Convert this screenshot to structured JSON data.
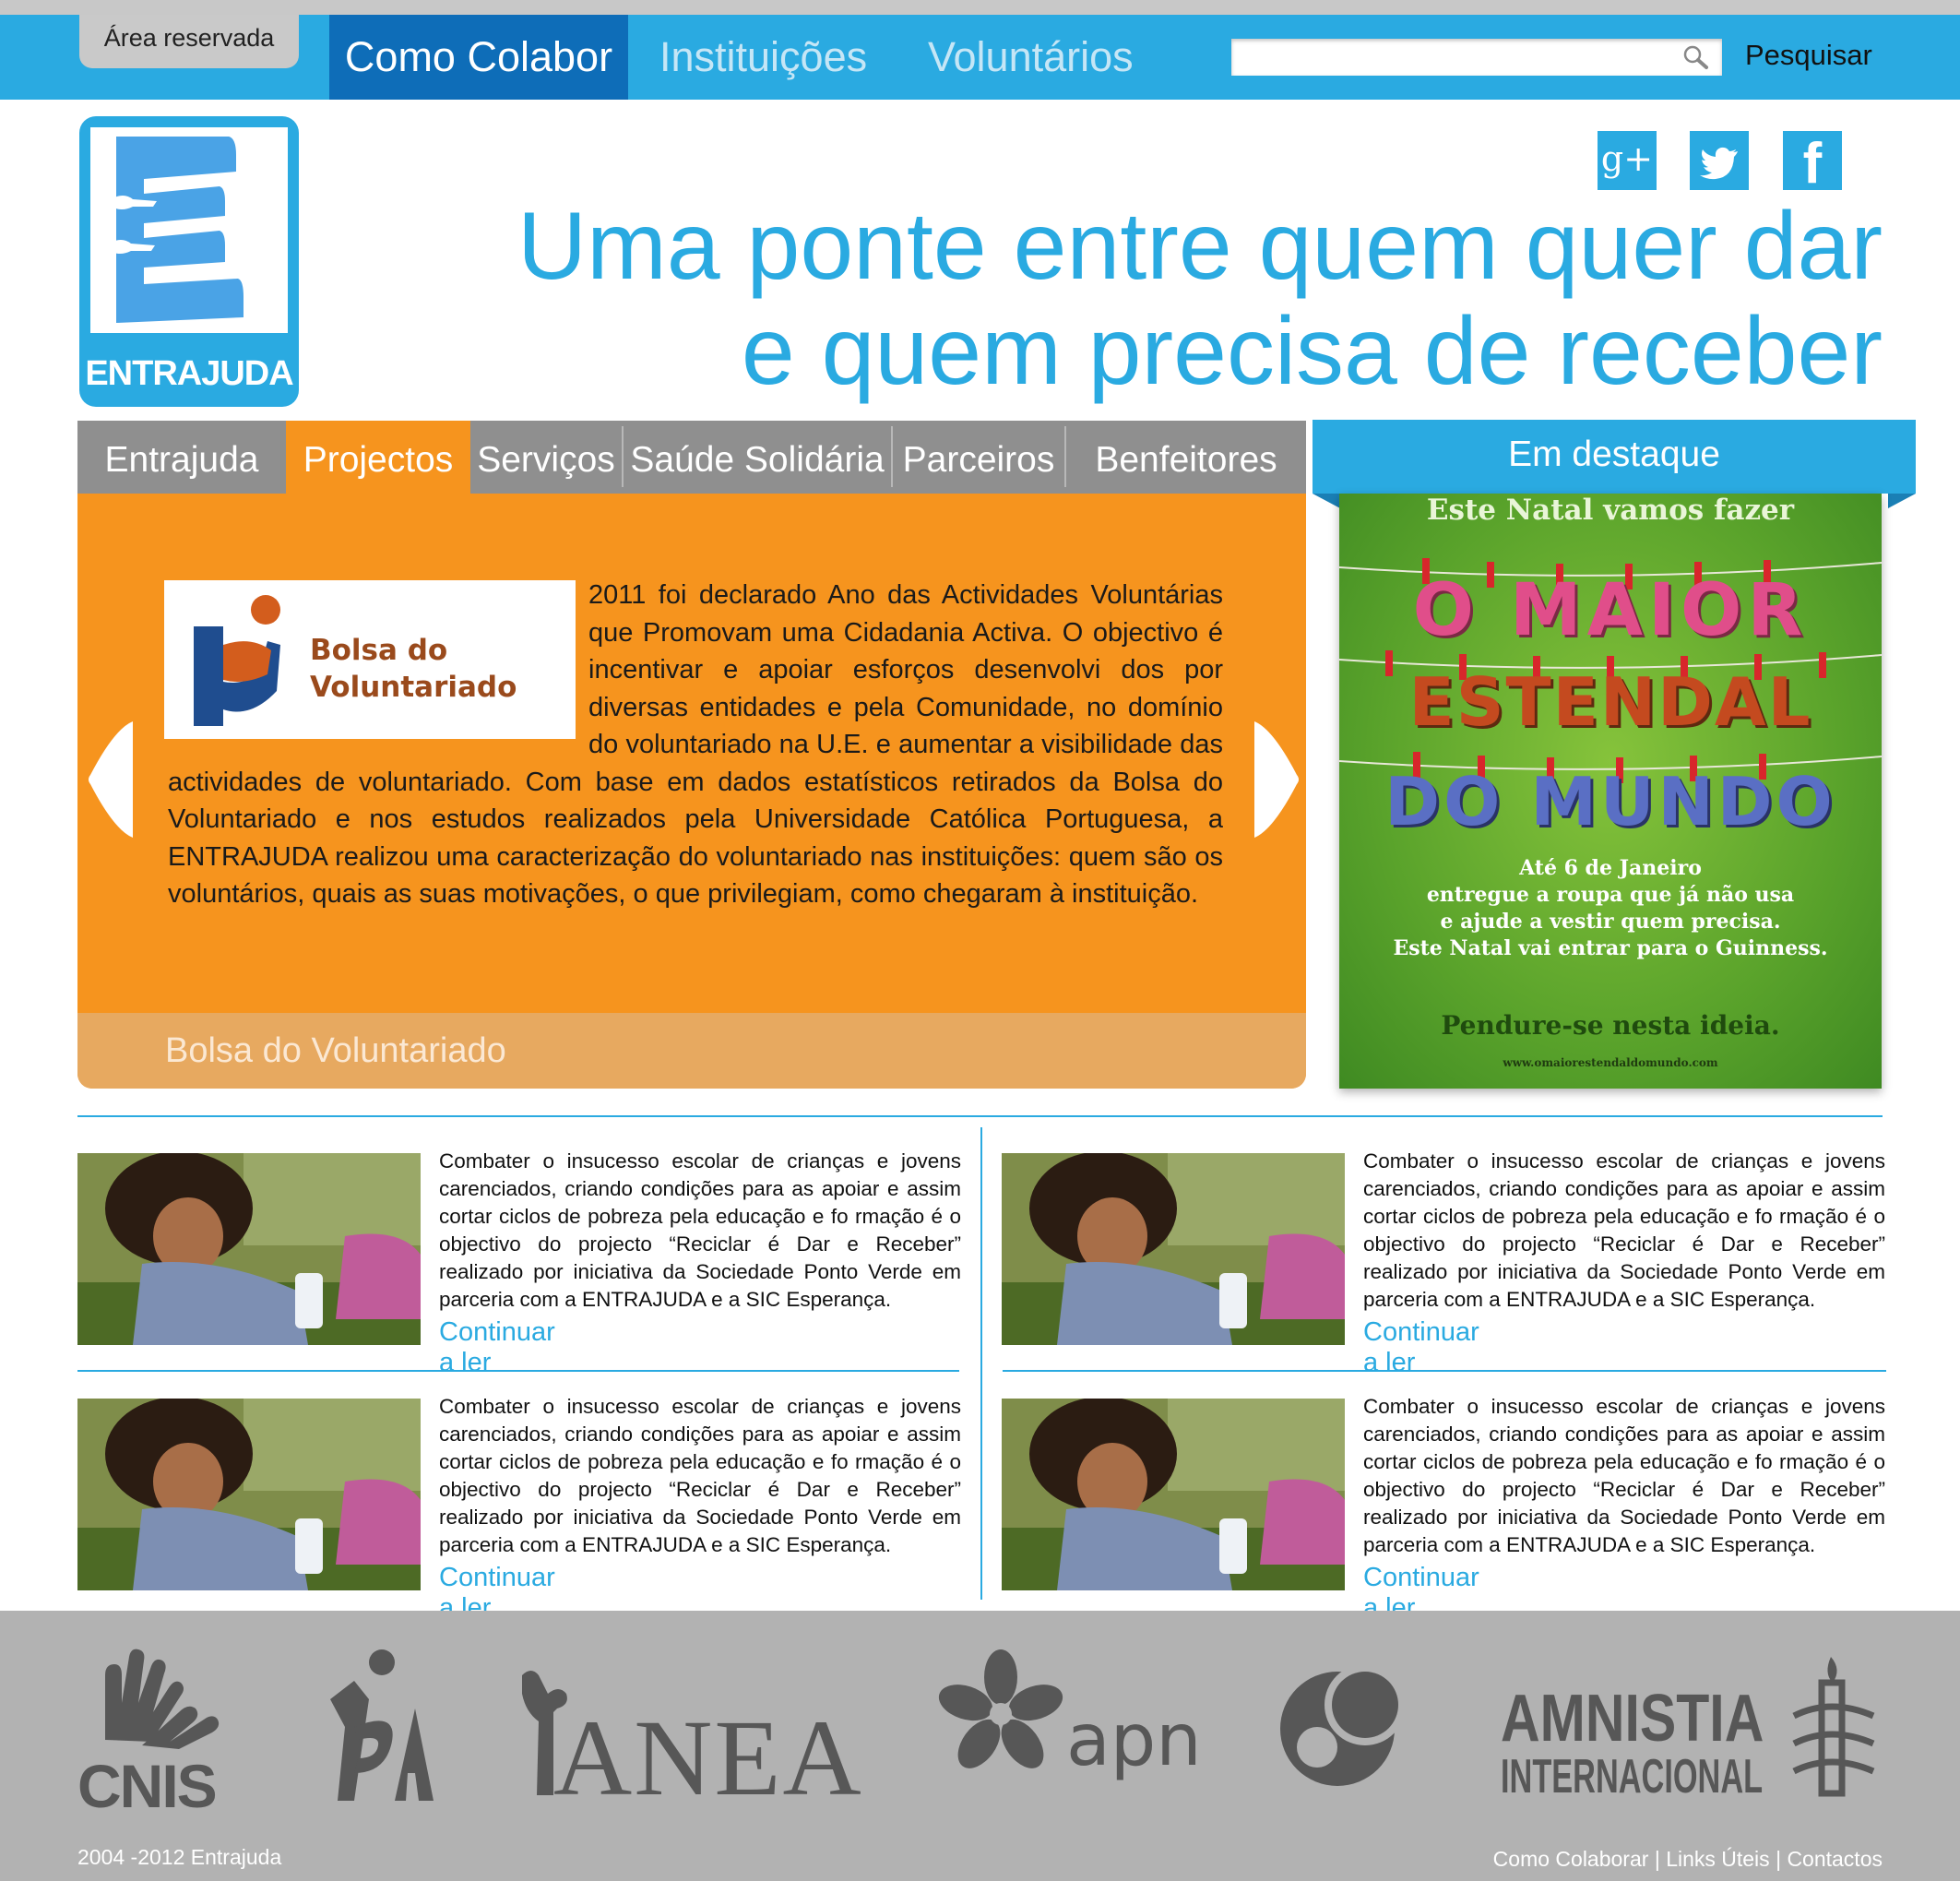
{
  "topbar": {
    "area_reservada": "Área reservada",
    "nav": [
      "Como Colabor",
      "Instituições",
      "Voluntários"
    ],
    "search_placeholder": "",
    "search_button": "Pesquisar"
  },
  "logo": {
    "text": "ENTRAJUDA"
  },
  "social": [
    {
      "icon": "google-plus-icon",
      "glyph": "g+"
    },
    {
      "icon": "twitter-icon",
      "glyph": ""
    },
    {
      "icon": "facebook-icon",
      "glyph": "f"
    }
  ],
  "headline": {
    "line1": "Uma ponte entre quem quer dar",
    "line2": "e quem precisa de receber"
  },
  "section_nav": [
    "Entrajuda",
    "Projectos",
    "Serviços",
    "Saúde Solidária",
    "Parceiros",
    "Benfeitores"
  ],
  "active_section": "Projectos",
  "feature": {
    "logo_text_1": "Bolsa do",
    "logo_text_2": "Voluntariado",
    "paragraph": "2011 foi declarado Ano das Actividades Voluntárias que Promovam uma Cidadania Activa. O objectivo é incentivar e apoiar esforços desenvolvi  dos por diversas entidades e pela  Comunidade, no domínio do voluntariado na U.E. e aumentar a visibilidade das actividades de voluntariado. Com base em dados estatísticos retirados da Bolsa do Voluntariado e nos estudos realizados pela Universidade Católica Portuguesa, a ENTRAJUDA realizou uma caracterização do voluntariado nas instituições: quem são os voluntários, quais as suas motivações, o que privilegiam, como chegaram à instituição.",
    "caption": "Bolsa do Voluntariado"
  },
  "destaque": {
    "title": "Em destaque",
    "poster": {
      "top": "Este Natal vamos fazer",
      "line1": "O MAIOR",
      "line2": "ESTENDAL",
      "line3": "DO MUNDO",
      "body": [
        "Até 6 de Janeiro",
        "entregue a roupa que já não usa",
        "e ajude a vestir quem precisa.",
        "Este Natal vai entrar para o Guinness."
      ],
      "slogan": "Pendure-se nesta ideia.",
      "url": "www.omaiorestendaldomundo.com"
    }
  },
  "news": [
    {
      "text": "Combater o insucesso escolar de crianças e jovens carenciados, criando condições para as apoiar e assim cortar ciclos de pobreza pela educação e fo rmação é o objectivo do projecto “Reciclar é Dar e Receber” realizado por iniciativa da Sociedade Ponto Verde em parceria com a ENTRAJUDA e a SIC Esperança.",
      "link": "Continuar a ler"
    },
    {
      "text": "Combater o insucesso escolar de crianças e jovens carenciados, criando condições para as apoiar e assim cortar ciclos de pobreza pela educação e fo rmação é o objectivo do projecto “Reciclar é Dar e Receber” realizado por iniciativa da Sociedade Ponto Verde em parceria com a ENTRAJUDA e a SIC Esperança.",
      "link": "Continuar a ler"
    },
    {
      "text": "Combater o insucesso escolar de crianças e jovens carenciados, criando condições para as apoiar e assim cortar ciclos de pobreza pela educação e fo rmação é o objectivo do projecto “Reciclar é Dar e Receber” realizado por iniciativa da Sociedade Ponto Verde em parceria com a ENTRAJUDA e a SIC Esperança.",
      "link": "Continuar a ler"
    },
    {
      "text": "Combater o insucesso escolar de crianças e jovens carenciados, criando condições para as apoiar e assim cortar ciclos de pobreza pela educação e fo rmação é o objectivo do projecto “Reciclar é Dar e Receber” realizado por iniciativa da Sociedade Ponto Verde em parceria com a ENTRAJUDA e a SIC Esperança.",
      "link": "Continuar a ler"
    }
  ],
  "partners": [
    "CNIS",
    "BA",
    "ANEA",
    "apn",
    "",
    "AMNISTIA",
    "INTERNACIONAL"
  ],
  "footer": {
    "copyright": "2004 -2012 Entrajuda",
    "links": [
      "Como Colaborar",
      "Links Úteis",
      "Contactos"
    ]
  },
  "colors": {
    "accent": "#2aaae1",
    "nav_active": "#0e6db8",
    "orange": "#f6941e",
    "footer": "#b2b2b2"
  }
}
